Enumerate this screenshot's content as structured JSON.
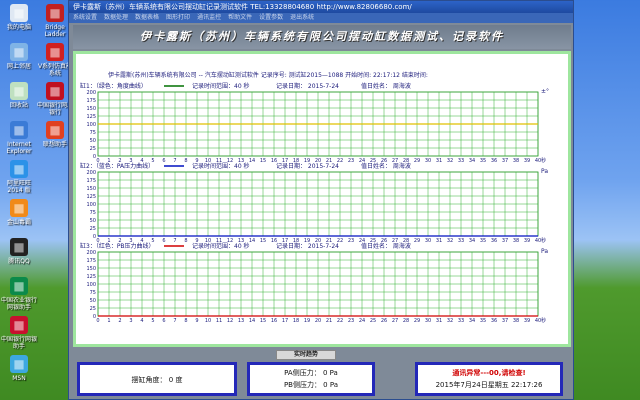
{
  "desktop_icons": [
    {
      "label": "我的电脑",
      "icon": "computer-icon",
      "color": "#dfe8f3"
    },
    {
      "label": "网上邻居",
      "icon": "network-icon",
      "color": "#7fb3e6"
    },
    {
      "label": "回收站",
      "icon": "recycle-bin-icon",
      "color": "#bfe0c0"
    },
    {
      "label": "Internet Explorer",
      "icon": "ie-icon",
      "color": "#3b7bd6"
    },
    {
      "label": "阿里旺旺 2014 版",
      "icon": "wangwang-icon",
      "color": "#2b92e8"
    },
    {
      "label": "金山毒霸",
      "icon": "antivirus-icon",
      "color": "#f08a1a"
    },
    {
      "label": "腾讯QQ",
      "icon": "qq-icon",
      "color": "#222222"
    },
    {
      "label": "中国农业银行网银助手",
      "icon": "abc-bank-icon",
      "color": "#0b8a4a"
    },
    {
      "label": "中国银行网银助手",
      "icon": "boc-bank-icon",
      "color": "#c8102e"
    },
    {
      "label": "MSN",
      "icon": "msn-icon",
      "color": "#3da8e0"
    },
    {
      "label": "Bridge Ladder",
      "icon": "bridge-icon",
      "color": "#c02020"
    },
    {
      "label": "V系列仿真能系统",
      "icon": "vseries-icon",
      "color": "#d02020"
    },
    {
      "label": "中国银行网上银行",
      "icon": "bank-icon",
      "color": "#c01020"
    },
    {
      "label": "联想助手",
      "icon": "lenovo-icon",
      "color": "#e04020"
    }
  ],
  "window": {
    "title": "伊卡露斯（苏州）车辆系统有限公司摆动缸记录测试软件  TEL:13328804680  http://www.82806680.com/",
    "menus": [
      "系统设置",
      "数据处理",
      "数据表格",
      "图形打印",
      "通讯监控",
      "帮助文件",
      "设置参数",
      "退出系统"
    ],
    "banner": "伊卡露斯（苏州）车辆系统有限公司摆动缸数据测试、记录软件"
  },
  "info": {
    "line": "伊卡露斯(苏州)车辆系统有限公司 -- 汽车摆动缸测试软件   记录序号:   测试缸2015—1088   开始时间:   22:17:12   结束时间:"
  },
  "charts": [
    {
      "header": "缸1：（绿色：角度曲线）",
      "curve_color": "#007000",
      "line_color": "#e0c000",
      "record_range": "记录时间范围：40 秒",
      "record_date": "记录日期：  2015-7-24",
      "operator": "值日姓名：  周海波",
      "unit": "±°",
      "y_ticks": [
        200,
        175,
        150,
        125,
        100,
        75,
        50,
        25,
        0
      ],
      "x_ticks": [
        0,
        1,
        2,
        3,
        4,
        5,
        6,
        7,
        8,
        9,
        10,
        11,
        12,
        13,
        14,
        15,
        16,
        17,
        18,
        19,
        20,
        21,
        22,
        23,
        24,
        25,
        26,
        27,
        28,
        29,
        30,
        31,
        32,
        33,
        34,
        35,
        36,
        37,
        38,
        39,
        40
      ],
      "x_unit": "秒",
      "series_value": 100
    },
    {
      "header": "缸2：（蓝色：PA压力曲线）",
      "curve_color": "#0010c0",
      "line_color": "#0010c0",
      "record_range": "记录时间范围：40 秒",
      "record_date": "记录日期：  2015-7-24",
      "operator": "值日姓名：  周海波",
      "unit": "Pa",
      "y_ticks": [
        200,
        175,
        150,
        125,
        100,
        75,
        50,
        25,
        0
      ],
      "x_ticks": [
        0,
        1,
        2,
        3,
        4,
        5,
        6,
        7,
        8,
        9,
        10,
        11,
        12,
        13,
        14,
        15,
        16,
        17,
        18,
        19,
        20,
        21,
        22,
        23,
        24,
        25,
        26,
        27,
        28,
        29,
        30,
        31,
        32,
        33,
        34,
        35,
        36,
        37,
        38,
        39,
        40
      ],
      "x_unit": "秒",
      "series_value": 0
    },
    {
      "header": "缸3：（红色：PB压力曲线）",
      "curve_color": "#d00000",
      "line_color": "#d00000",
      "record_range": "记录时间范围：40 秒",
      "record_date": "记录日期：  2015-7-24",
      "operator": "值日姓名：  周海波",
      "unit": "Pa",
      "y_ticks": [
        200,
        175,
        150,
        125,
        100,
        75,
        50,
        25,
        0
      ],
      "x_ticks": [
        0,
        1,
        2,
        3,
        4,
        5,
        6,
        7,
        8,
        9,
        10,
        11,
        12,
        13,
        14,
        15,
        16,
        17,
        18,
        19,
        20,
        21,
        22,
        23,
        24,
        25,
        26,
        27,
        28,
        29,
        30,
        31,
        32,
        33,
        34,
        35,
        36,
        37,
        38,
        39,
        40
      ],
      "x_unit": "秒",
      "series_value": 0
    }
  ],
  "chart_data": [
    {
      "type": "line",
      "series_color": "#e0c000",
      "x": [
        0,
        40
      ],
      "y": [
        100,
        100
      ],
      "xlim": [
        0,
        40
      ],
      "ylim": [
        0,
        200
      ],
      "ylabel": "±°",
      "grid": true
    },
    {
      "type": "line",
      "series_color": "#0010c0",
      "x": [
        0,
        40
      ],
      "y": [
        0,
        0
      ],
      "xlim": [
        0,
        40
      ],
      "ylim": [
        0,
        200
      ],
      "ylabel": "Pa",
      "grid": true
    },
    {
      "type": "line",
      "series_color": "#d00000",
      "x": [
        0,
        40
      ],
      "y": [
        0,
        0
      ],
      "xlim": [
        0,
        40
      ],
      "ylim": [
        0,
        200
      ],
      "ylabel": "Pa",
      "grid": true
    }
  ],
  "controls": {
    "realtime_button": "实时趋势"
  },
  "status": {
    "angle": "摆缸角度：  0 度",
    "pa": "PA侧压力：  0 Pa",
    "pb": "PB侧压力：  0 Pa",
    "comm_error": "通讯异常---00,请检查!",
    "datetime": "2015年7月24日星期五    22:17:26"
  },
  "colors": {
    "grid": "#30b030",
    "panel_border": "#9ee69e",
    "status_border": "#2428b8",
    "error": "#d00000"
  }
}
